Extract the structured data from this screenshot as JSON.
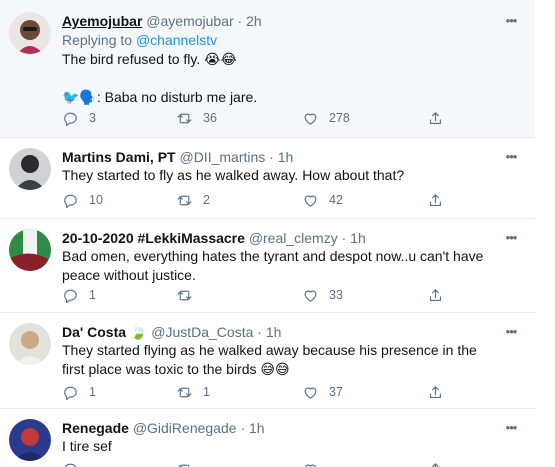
{
  "tweets": [
    {
      "name": "Ayemojubar",
      "handle": "@ayemojubar",
      "time": "2h",
      "replying_label": "Replying to",
      "replying_to": "@channelstv",
      "text": "The bird refused to fly. 😭😂\n\n🐦🗣️: Baba no disturb me jare.",
      "replies": "3",
      "retweets": "36",
      "likes": "278"
    },
    {
      "name": "Martins Dami, PT",
      "handle": "@DII_martins",
      "time": "1h",
      "text": "They started to fly as he walked away. How about that?",
      "replies": "10",
      "retweets": "2",
      "likes": "42"
    },
    {
      "name": "20-10-2020 #LekkiMassacre",
      "handle": "@real_clemzy",
      "time": "1h",
      "text": "Bad omen, everything hates the tyrant and despot now..u can't have peace without justice.",
      "replies": "1",
      "retweets": "",
      "likes": "33"
    },
    {
      "name": "Da' Costa 🍃",
      "handle": "@JustDa_Costa",
      "time": "1h",
      "text": "They started flying as he walked away because his presence in the first place was toxic to the birds 😅😅",
      "replies": "1",
      "retweets": "1",
      "likes": "37"
    },
    {
      "name": "Renegade",
      "handle": "@GidiRenegade",
      "time": "1h",
      "text": "I tire sef",
      "replies": "",
      "retweets": "",
      "likes": ""
    }
  ],
  "dot": "·",
  "more_glyph": "•••",
  "colors": {
    "muted": "#5b7083",
    "link": "#1b95e0",
    "divider": "#e6ecf0",
    "highlight_bg": "#f5f8fa"
  },
  "icons": [
    "reply-icon",
    "retweet-icon",
    "like-icon",
    "share-icon",
    "more-icon"
  ]
}
